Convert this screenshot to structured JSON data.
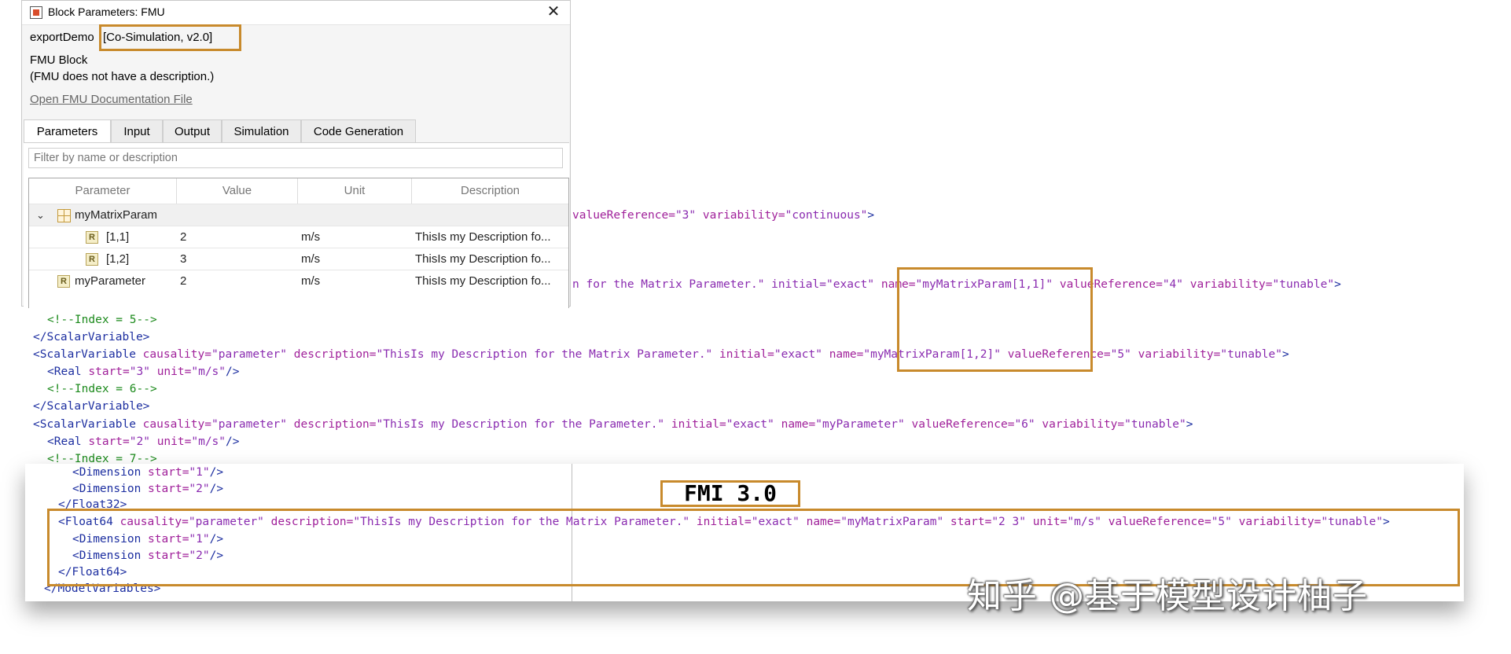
{
  "dialog": {
    "title": "Block Parameters: FMU",
    "close_glyph": "✕",
    "fmu_name": "exportDemo",
    "fmu_version": "[Co-Simulation, v2.0]",
    "block_type": "FMU Block",
    "description": "(FMU does not have a description.)",
    "doc_link": "Open FMU Documentation File",
    "tabs": [
      "Parameters",
      "Input",
      "Output",
      "Simulation",
      "Code Generation"
    ],
    "active_tab": "Parameters",
    "filter_placeholder": "Filter by name or description",
    "table": {
      "columns": [
        "Parameter",
        "Value",
        "Unit",
        "Description"
      ],
      "group": "myMatrixParam",
      "rows": [
        {
          "icon": "R",
          "param": "[1,1]",
          "value": "2",
          "unit": "m/s",
          "desc": "ThisIs my Description fo..."
        },
        {
          "icon": "R",
          "param": "[1,2]",
          "value": "3",
          "unit": "m/s",
          "desc": "ThisIs my Description fo..."
        },
        {
          "icon": "R",
          "param": "myParameter",
          "value": "2",
          "unit": "m/s",
          "desc": "ThisIs my Description fo..."
        }
      ]
    }
  },
  "code_bg": {
    "l1": {
      "a": "valueReference=",
      "b": "\"3\"",
      "c": " variability=",
      "d": "\"continuous\"",
      "e": ">"
    },
    "l2": {
      "a": "n for the Matrix Parameter.\" initial=",
      "b": "\"exact\"",
      "c": " name=",
      "d": "\"myMatrixParam[1,1]\"",
      "e": " valueReference=",
      "f": "\"4\"",
      "g": " variability=",
      "h": "\"tunable\"",
      "i": ">"
    },
    "l3": {
      "text": "<!--Index = 5-->"
    },
    "l4": {
      "text": "</ScalarVariable>"
    },
    "l5": {
      "t": "<ScalarVariable",
      "a1": " causality=",
      "v1": "\"parameter\"",
      "a2": " description=",
      "v2": "\"ThisIs my Description for the Matrix Parameter.\"",
      "a3": " initial=",
      "v3": "\"exact\"",
      "a4": " name=",
      "v4": "\"myMatrixParam[1,2]\"",
      "a5": " valueReference=",
      "v5": "\"5\"",
      "a6": " variability=",
      "v6": "\"tunable\"",
      "e": ">"
    },
    "l6": {
      "t": "<Real",
      "a1": " start=",
      "v1": "\"3\"",
      "a2": " unit=",
      "v2": "\"m/s\"",
      "e": "/>"
    },
    "l7": {
      "text": "<!--Index = 6-->"
    },
    "l8": {
      "text": "</ScalarVariable>"
    },
    "l9": {
      "t": "<ScalarVariable",
      "a1": " causality=",
      "v1": "\"parameter\"",
      "a2": " description=",
      "v2": "\"ThisIs my Description for the Parameter.\"",
      "a3": " initial=",
      "v3": "\"exact\"",
      "a4": " name=",
      "v4": "\"myParameter\"",
      "a5": " valueReference=",
      "v5": "\"6\"",
      "a6": " variability=",
      "v6": "\"tunable\"",
      "e": ">"
    },
    "l10": {
      "t": "<Real",
      "a1": " start=",
      "v1": "\"2\"",
      "a2": " unit=",
      "v2": "\"m/s\"",
      "e": "/>"
    },
    "l11": {
      "text": "<!--Index = 7-->"
    }
  },
  "fmi3": {
    "label": "FMI 3.0",
    "l1": {
      "t": "<Dimension",
      "a": " start=",
      "v": "\"1\"",
      "e": "/>"
    },
    "l2": {
      "t": "<Dimension",
      "a": " start=",
      "v": "\"2\"",
      "e": "/>"
    },
    "l3": {
      "text": "</Float32>"
    },
    "l4": {
      "t": "<Float64",
      "a1": " causality=",
      "v1": "\"parameter\"",
      "a2": " description=",
      "v2": "\"ThisIs my Description for the Matrix Parameter.\"",
      "a3": " initial=",
      "v3": "\"exact\"",
      "a4": " name=",
      "v4": "\"myMatrixParam\"",
      "a5": " start=",
      "v5": "\"2 3\"",
      "a6": " unit=",
      "v6": "\"m/s\"",
      "a7": " valueReference=",
      "v7": "\"5\"",
      "a8": " variability=",
      "v8": "\"tunable\"",
      "e": ">"
    },
    "l5": {
      "t": "<Dimension",
      "a": " start=",
      "v": "\"1\"",
      "e": "/>"
    },
    "l6": {
      "t": "<Dimension",
      "a": " start=",
      "v": "\"2\"",
      "e": "/>"
    },
    "l7": {
      "text": "</Float64>"
    },
    "l8": {
      "text": "</ModelVariables>"
    }
  },
  "watermark": "知乎 @基于模型设计柚子",
  "colors": {
    "highlight": "#c88a2c",
    "tag": "#1c2ea0",
    "attr": "#a0209a",
    "comment": "#1c8a1c"
  }
}
